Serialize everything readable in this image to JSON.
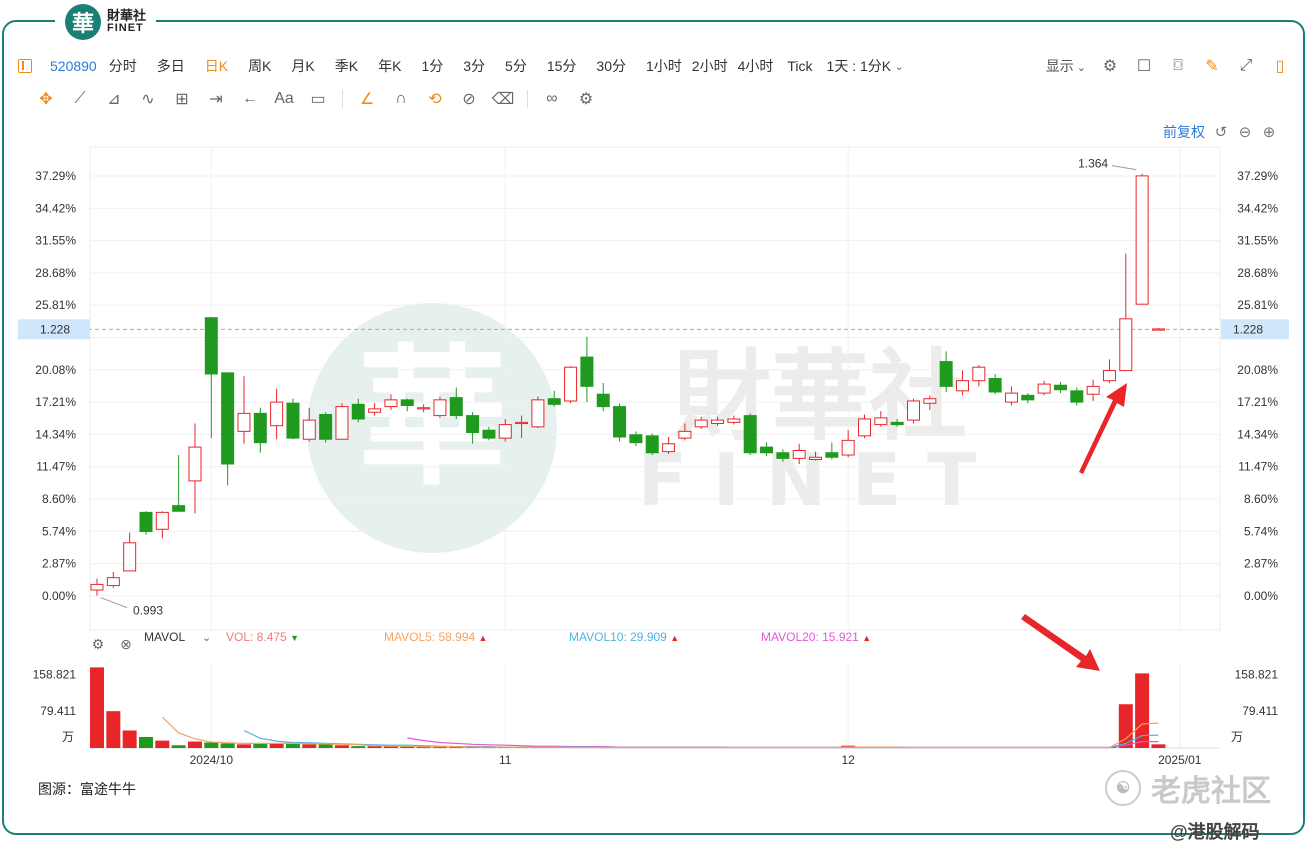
{
  "brand": {
    "seal": "華",
    "name_cn": "財華社",
    "name_en": "FINET"
  },
  "toolbar": {
    "code": "520890",
    "tabs": [
      "分时",
      "多日",
      "日K",
      "周K",
      "月K",
      "季K",
      "年K",
      "1分",
      "3分",
      "5分",
      "15分",
      "30分",
      "1小时",
      "2小时",
      "4小时",
      "Tick"
    ],
    "active_tab": "日K",
    "period_select": "1天 : 1分K",
    "display_label": "显示"
  },
  "adjust": {
    "label": "前复权"
  },
  "colors": {
    "up": "#e8262a",
    "down": "#1f9a1f",
    "price_line": "#f0a030",
    "mavol5": "#f5a360",
    "mavol10": "#4fb3e0",
    "mavol20": "#e05ad8",
    "accent": "#2b7bd6",
    "frame": "#1a7f74"
  },
  "chart_data": {
    "type": "candlestick",
    "y_axis_left": [
      "37.29%",
      "34.42%",
      "31.55%",
      "28.68%",
      "25.81%",
      "20.08%",
      "17.21%",
      "14.34%",
      "11.47%",
      "8.60%",
      "5.74%",
      "2.87%",
      "0.00%"
    ],
    "y_axis_right": [
      "37.29%",
      "34.42%",
      "31.55%",
      "28.68%",
      "25.81%",
      "20.08%",
      "17.21%",
      "14.34%",
      "11.47%",
      "8.60%",
      "5.74%",
      "2.87%",
      "0.00%"
    ],
    "base_price": 0.993,
    "last_price": {
      "label": "1.228",
      "value": 1.228
    },
    "high_label": "1.364",
    "low_label": "0.993",
    "x_labels": [
      {
        "label": "2024/10",
        "index": 7
      },
      {
        "label": "11",
        "index": 25
      },
      {
        "label": "12",
        "index": 46
      },
      {
        "label": "2025/01",
        "index": 66
      }
    ],
    "candles": [
      {
        "o": 0.5,
        "c": 1.0,
        "h": 1.5,
        "l": 0.0
      },
      {
        "o": 0.9,
        "c": 1.6,
        "h": 2.1,
        "l": 0.7
      },
      {
        "o": 2.2,
        "c": 4.7,
        "h": 5.6,
        "l": 2.2
      },
      {
        "o": 7.4,
        "c": 5.7,
        "h": 7.5,
        "l": 5.4
      },
      {
        "o": 5.9,
        "c": 7.4,
        "h": 7.5,
        "l": 5.1
      },
      {
        "o": 8.0,
        "c": 7.5,
        "h": 12.5,
        "l": 7.5
      },
      {
        "o": 10.2,
        "c": 13.2,
        "h": 15.3,
        "l": 7.3
      },
      {
        "o": 24.7,
        "c": 19.7,
        "h": 24.7,
        "l": 14.0
      },
      {
        "o": 19.8,
        "c": 11.7,
        "h": 19.8,
        "l": 9.8
      },
      {
        "o": 14.6,
        "c": 16.2,
        "h": 19.5,
        "l": 13.5
      },
      {
        "o": 16.2,
        "c": 13.6,
        "h": 16.7,
        "l": 12.7
      },
      {
        "o": 15.1,
        "c": 17.2,
        "h": 18.4,
        "l": 13.9
      },
      {
        "o": 17.1,
        "c": 14.0,
        "h": 17.5,
        "l": 13.9
      },
      {
        "o": 13.9,
        "c": 15.6,
        "h": 16.7,
        "l": 13.7
      },
      {
        "o": 16.1,
        "c": 13.9,
        "h": 16.3,
        "l": 13.6
      },
      {
        "o": 13.9,
        "c": 16.8,
        "h": 17.1,
        "l": 13.9
      },
      {
        "o": 17.0,
        "c": 15.7,
        "h": 17.5,
        "l": 15.4
      },
      {
        "o": 16.3,
        "c": 16.6,
        "h": 17.1,
        "l": 16.0
      },
      {
        "o": 16.8,
        "c": 17.4,
        "h": 17.9,
        "l": 16.5
      },
      {
        "o": 17.4,
        "c": 16.9,
        "h": 17.5,
        "l": 16.4
      },
      {
        "o": 16.7,
        "c": 16.7,
        "h": 17.0,
        "l": 16.3
      },
      {
        "o": 16.0,
        "c": 17.4,
        "h": 17.7,
        "l": 15.8
      },
      {
        "o": 17.6,
        "c": 16.0,
        "h": 18.5,
        "l": 15.7
      },
      {
        "o": 16.0,
        "c": 14.5,
        "h": 16.3,
        "l": 13.5
      },
      {
        "o": 14.7,
        "c": 14.0,
        "h": 15.0,
        "l": 13.8
      },
      {
        "o": 14.0,
        "c": 15.2,
        "h": 15.7,
        "l": 13.7
      },
      {
        "o": 15.3,
        "c": 15.4,
        "h": 16.0,
        "l": 14.0
      },
      {
        "o": 15.0,
        "c": 17.4,
        "h": 17.7,
        "l": 14.9
      },
      {
        "o": 17.5,
        "c": 17.0,
        "h": 18.2,
        "l": 16.8
      },
      {
        "o": 17.3,
        "c": 20.3,
        "h": 20.4,
        "l": 17.1
      },
      {
        "o": 21.2,
        "c": 18.6,
        "h": 23.0,
        "l": 17.2
      },
      {
        "o": 17.9,
        "c": 16.8,
        "h": 18.9,
        "l": 16.4
      },
      {
        "o": 16.8,
        "c": 14.1,
        "h": 17.1,
        "l": 13.7
      },
      {
        "o": 14.3,
        "c": 13.6,
        "h": 14.6,
        "l": 13.3
      },
      {
        "o": 14.2,
        "c": 12.7,
        "h": 14.4,
        "l": 12.5
      },
      {
        "o": 12.8,
        "c": 13.5,
        "h": 14.1,
        "l": 12.6
      },
      {
        "o": 14.0,
        "c": 14.6,
        "h": 15.3,
        "l": 13.8
      },
      {
        "o": 15.0,
        "c": 15.6,
        "h": 15.9,
        "l": 14.8
      },
      {
        "o": 15.3,
        "c": 15.6,
        "h": 15.9,
        "l": 15.1
      },
      {
        "o": 15.4,
        "c": 15.7,
        "h": 16.0,
        "l": 15.2
      },
      {
        "o": 16.0,
        "c": 12.7,
        "h": 16.2,
        "l": 12.5
      },
      {
        "o": 13.2,
        "c": 12.7,
        "h": 13.6,
        "l": 12.4
      },
      {
        "o": 12.7,
        "c": 12.2,
        "h": 13.0,
        "l": 11.9
      },
      {
        "o": 12.2,
        "c": 12.9,
        "h": 13.5,
        "l": 11.7
      },
      {
        "o": 12.1,
        "c": 12.3,
        "h": 12.8,
        "l": 12.0
      },
      {
        "o": 12.7,
        "c": 12.3,
        "h": 13.6,
        "l": 12.1
      },
      {
        "o": 12.5,
        "c": 13.8,
        "h": 14.7,
        "l": 12.3
      },
      {
        "o": 14.2,
        "c": 15.7,
        "h": 16.1,
        "l": 14.0
      },
      {
        "o": 15.2,
        "c": 15.8,
        "h": 16.4,
        "l": 15.0
      },
      {
        "o": 15.4,
        "c": 15.2,
        "h": 15.7,
        "l": 15.0
      },
      {
        "o": 15.6,
        "c": 17.3,
        "h": 17.5,
        "l": 15.3
      },
      {
        "o": 17.1,
        "c": 17.5,
        "h": 17.8,
        "l": 16.5
      },
      {
        "o": 20.8,
        "c": 18.6,
        "h": 21.7,
        "l": 18.1
      },
      {
        "o": 18.2,
        "c": 19.1,
        "h": 20.0,
        "l": 17.8
      },
      {
        "o": 19.1,
        "c": 20.3,
        "h": 20.5,
        "l": 18.6
      },
      {
        "o": 19.3,
        "c": 18.1,
        "h": 19.7,
        "l": 17.9
      },
      {
        "o": 17.2,
        "c": 18.0,
        "h": 18.6,
        "l": 16.9
      },
      {
        "o": 17.8,
        "c": 17.4,
        "h": 18.0,
        "l": 17.1
      },
      {
        "o": 18.0,
        "c": 18.8,
        "h": 19.1,
        "l": 17.8
      },
      {
        "o": 18.7,
        "c": 18.3,
        "h": 19.0,
        "l": 18.0
      },
      {
        "o": 18.2,
        "c": 17.2,
        "h": 18.5,
        "l": 16.9
      },
      {
        "o": 17.9,
        "c": 18.6,
        "h": 19.2,
        "l": 17.3
      },
      {
        "o": 19.1,
        "c": 20.0,
        "h": 21.0,
        "l": 18.9
      },
      {
        "o": 20.0,
        "c": 24.6,
        "h": 30.4,
        "l": 20.0
      },
      {
        "o": 25.9,
        "c": 37.3,
        "h": 37.5,
        "l": 25.9
      },
      {
        "o": 23.7,
        "c": 23.7,
        "h": 23.8,
        "l": 23.6
      }
    ],
    "volume": {
      "y_labels": [
        "158.821",
        "79.411"
      ],
      "unit": "万",
      "max": 178,
      "bars": [
        175,
        80,
        38,
        24,
        16,
        6,
        14,
        12,
        10,
        8,
        9,
        10,
        11,
        8,
        8,
        6,
        4,
        4,
        4,
        3,
        3,
        3,
        2,
        2,
        2,
        2,
        2,
        2,
        1,
        1,
        1,
        1,
        1,
        1,
        1,
        1,
        1,
        1,
        1,
        1,
        1,
        1,
        1,
        1,
        1,
        1,
        5,
        1,
        1,
        1,
        1,
        1,
        1,
        1,
        1,
        1,
        1,
        1,
        1,
        1,
        1,
        1,
        1,
        95,
        162,
        8
      ],
      "mavol5": [
        null,
        null,
        null,
        null,
        67,
        33,
        20,
        13,
        11,
        10,
        10,
        10,
        10,
        9,
        9,
        8,
        7,
        5,
        4,
        4,
        3,
        3,
        3,
        2,
        2,
        2,
        2,
        2,
        2,
        1,
        1,
        1,
        1,
        1,
        1,
        1,
        1,
        1,
        1,
        1,
        1,
        1,
        1,
        1,
        1,
        1,
        2,
        2,
        2,
        2,
        1,
        1,
        1,
        1,
        1,
        1,
        1,
        1,
        1,
        1,
        1,
        1,
        1,
        20,
        52,
        54
      ],
      "mavol10": [
        null,
        null,
        null,
        null,
        null,
        null,
        null,
        null,
        null,
        38,
        21,
        15,
        12,
        11,
        10,
        9,
        8,
        7,
        6,
        6,
        5,
        4,
        3,
        3,
        3,
        2,
        2,
        2,
        2,
        2,
        2,
        1,
        1,
        1,
        1,
        1,
        1,
        1,
        1,
        1,
        1,
        1,
        1,
        1,
        1,
        1,
        1,
        1,
        1,
        1,
        1,
        1,
        1,
        1,
        1,
        1,
        1,
        1,
        1,
        1,
        1,
        1,
        1,
        10,
        27,
        28
      ],
      "mavol20": [
        null,
        null,
        null,
        null,
        null,
        null,
        null,
        null,
        null,
        null,
        null,
        null,
        null,
        null,
        null,
        null,
        null,
        null,
        null,
        22,
        16,
        12,
        10,
        8,
        7,
        6,
        5,
        4,
        4,
        3,
        3,
        3,
        2,
        2,
        2,
        2,
        2,
        2,
        2,
        1,
        1,
        1,
        1,
        1,
        1,
        1,
        1,
        1,
        1,
        1,
        1,
        1,
        1,
        1,
        1,
        1,
        1,
        1,
        1,
        1,
        1,
        1,
        1,
        6,
        14,
        14
      ]
    },
    "legend": {
      "name": "MAVOL",
      "vol": "VOL: 8.475",
      "mavol5": "MAVOL5: 58.994",
      "mavol10": "MAVOL10: 29.909",
      "mavol20": "MAVOL20: 15.921"
    }
  },
  "source": "图源：富途牛牛",
  "watermark": {
    "brand": "老虎社区",
    "handle": "@港股解码",
    "center_cn": "財華社",
    "center_en": "FINET"
  }
}
